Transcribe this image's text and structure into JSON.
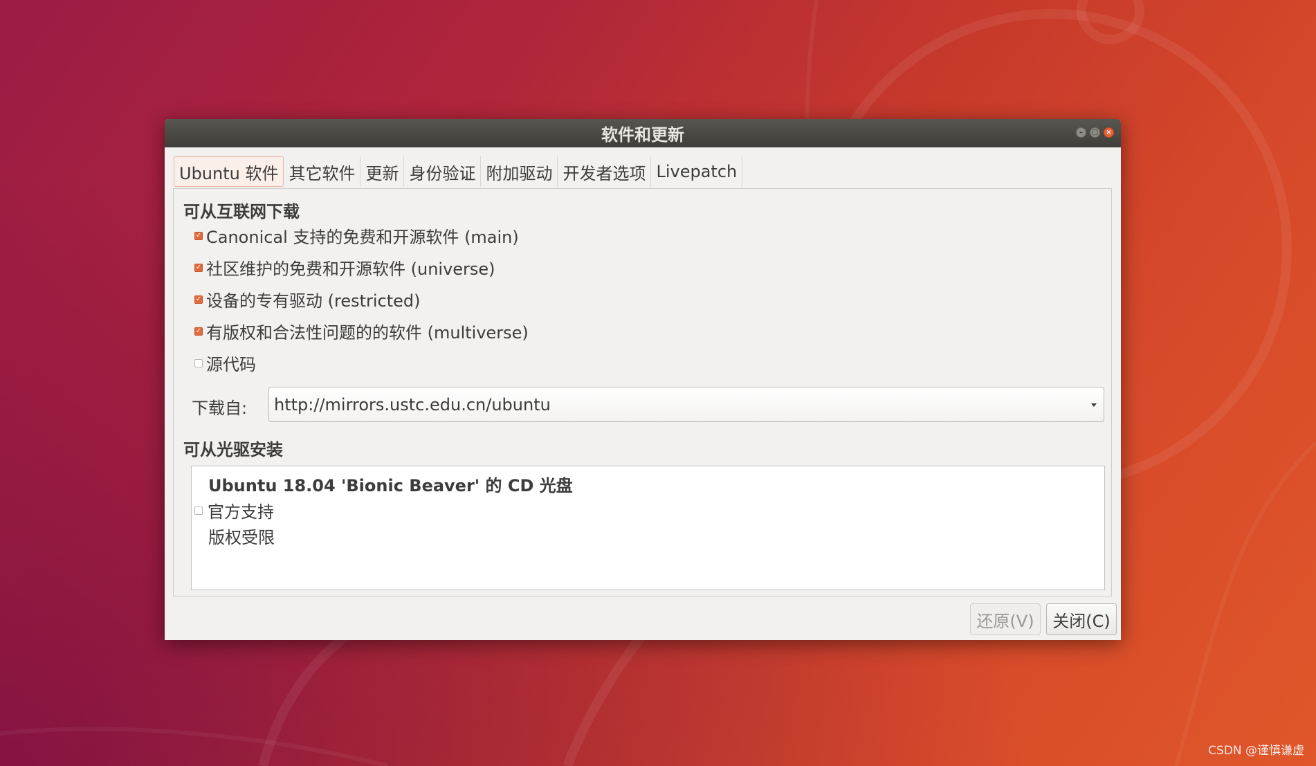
{
  "window": {
    "title": "软件和更新"
  },
  "tabs": [
    {
      "label": "Ubuntu 软件",
      "active": true
    },
    {
      "label": "其它软件",
      "active": false
    },
    {
      "label": "更新",
      "active": false
    },
    {
      "label": "身份验证",
      "active": false
    },
    {
      "label": "附加驱动",
      "active": false
    },
    {
      "label": "开发者选项",
      "active": false
    },
    {
      "label": "Livepatch",
      "active": false
    }
  ],
  "internet": {
    "title": "可从互联网下载",
    "options": [
      {
        "label": "Canonical 支持的免费和开源软件 (main)",
        "checked": true
      },
      {
        "label": "社区维护的免费和开源软件 (universe)",
        "checked": true
      },
      {
        "label": "设备的专有驱动 (restricted)",
        "checked": true
      },
      {
        "label": "有版权和合法性问题的的软件 (multiverse)",
        "checked": true
      },
      {
        "label": "源代码",
        "checked": false
      }
    ],
    "download_from_label": "下载自:",
    "download_from_value": "http://mirrors.ustc.edu.cn/ubuntu"
  },
  "cdrom": {
    "title": "可从光驱安装",
    "disc_name": "Ubuntu 18.04 'Bionic Beaver' 的 CD 光盘",
    "official_label": "官方支持",
    "official_checked": false,
    "restricted_label": "版权受限"
  },
  "buttons": {
    "revert": "还原(V)",
    "close": "关闭(C)"
  },
  "watermark": "CSDN @谨慎谦虚",
  "colors": {
    "accent": "#e36a3c",
    "titlebar": "#4a4944",
    "window_bg": "#f2f1f0"
  }
}
